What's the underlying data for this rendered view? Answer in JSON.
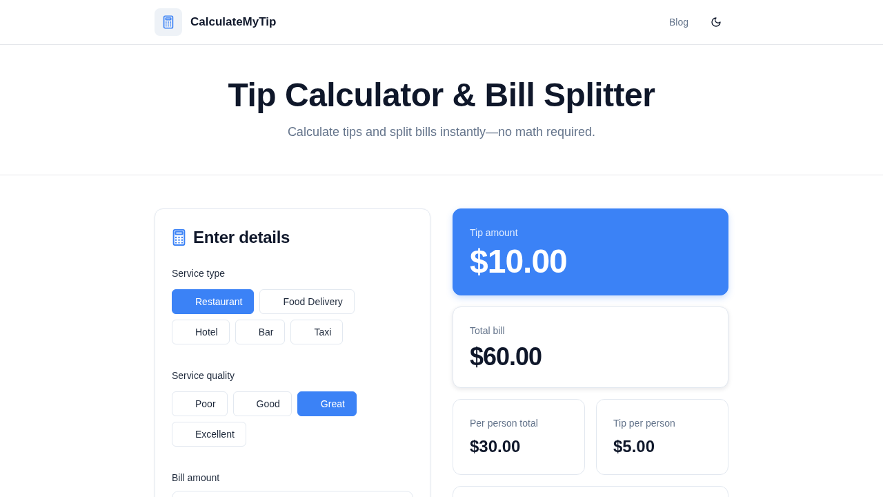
{
  "header": {
    "brand": "CalculateMyTip",
    "nav": [
      {
        "label": "Blog"
      }
    ]
  },
  "hero": {
    "title": "Tip Calculator & Bill Splitter",
    "subtitle": "Calculate tips and split bills instantly—no math required."
  },
  "details": {
    "title": "Enter details",
    "groups": [
      {
        "label": "Service type",
        "options": [
          {
            "label": "Restaurant",
            "selected": true
          },
          {
            "label": "Food Delivery",
            "selected": false
          },
          {
            "label": "Hotel",
            "selected": false
          },
          {
            "label": "Bar",
            "selected": false
          },
          {
            "label": "Taxi",
            "selected": false
          }
        ]
      },
      {
        "label": "Service quality",
        "options": [
          {
            "label": "Poor",
            "selected": false
          },
          {
            "label": "Good",
            "selected": false
          },
          {
            "label": "Great",
            "selected": true
          },
          {
            "label": "Excellent",
            "selected": false
          }
        ]
      }
    ],
    "bill": {
      "label": "Bill amount"
    }
  },
  "results": [
    {
      "kind": "primary",
      "label": "Tip amount",
      "value": "$10.00"
    },
    {
      "kind": "total",
      "label": "Total bill",
      "value": "$60.00"
    },
    {
      "kind": "split",
      "label": "Per person total",
      "value": "$30.00"
    },
    {
      "kind": "split",
      "label": "Tip per person",
      "value": "$5.00"
    }
  ]
}
